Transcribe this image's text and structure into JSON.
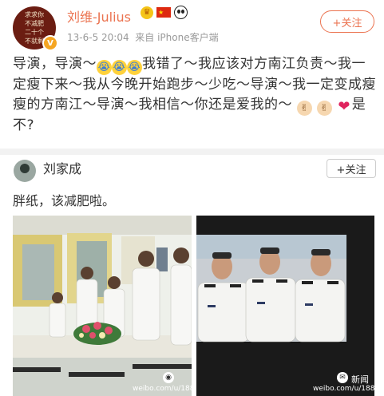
{
  "post": {
    "avatar_text": [
      "求求你",
      "不减肥",
      "二十个",
      "不就剩"
    ],
    "verified_mark": "V",
    "username": "刘维-Julius",
    "user_badges": [
      "crown-icon",
      "china-flag-icon",
      "panda-icon"
    ],
    "timestamp": "13-6-5 20:04",
    "source": "来自 iPhone客户端",
    "follow_label": "+关注",
    "content_parts": [
      "导演，导演～",
      "我错了～我应该对方南江负责～我一定瘦下来～我从今晚开始跑步～少吃～导演～我一定变成瘦瘦的方南江～导演～我相信～你还是爱我的～",
      "是不?"
    ],
    "emoji_cry": "😭",
    "emoji_hand": "✌",
    "emoji_heart": "❤"
  },
  "repost": {
    "username": "刘家成",
    "follow_label": "+关注",
    "content": "胖纸，该减肥啦。",
    "photos": [
      {
        "name": "classroom-photo",
        "watermark": "weibo.com/u/188"
      },
      {
        "name": "screen-photo",
        "watermark": "weibo.com/u/188",
        "overlay_text": "新闻"
      }
    ]
  },
  "colors": {
    "accent": "#eb7350",
    "text": "#333333",
    "meta": "#999999",
    "divider": "#f2f2f2"
  }
}
